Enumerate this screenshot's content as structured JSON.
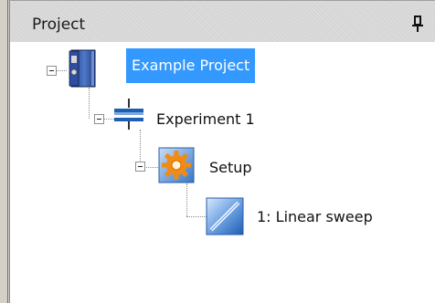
{
  "panel": {
    "title": "Project",
    "pin_icon": "pin-icon"
  },
  "tree": {
    "nodes": [
      {
        "label": "Example Project",
        "icon": "project-binder-icon",
        "selected": true,
        "expanded": true
      },
      {
        "label": "Experiment 1",
        "icon": "experiment-icon",
        "selected": false,
        "expanded": true
      },
      {
        "label": "Setup",
        "icon": "setup-gear-icon",
        "selected": false,
        "expanded": true
      },
      {
        "label": "1: Linear sweep",
        "icon": "linear-sweep-icon",
        "selected": false,
        "expanded": false
      }
    ]
  },
  "colors": {
    "selection": "#3399ff",
    "header_background": "#dcdcdc"
  }
}
